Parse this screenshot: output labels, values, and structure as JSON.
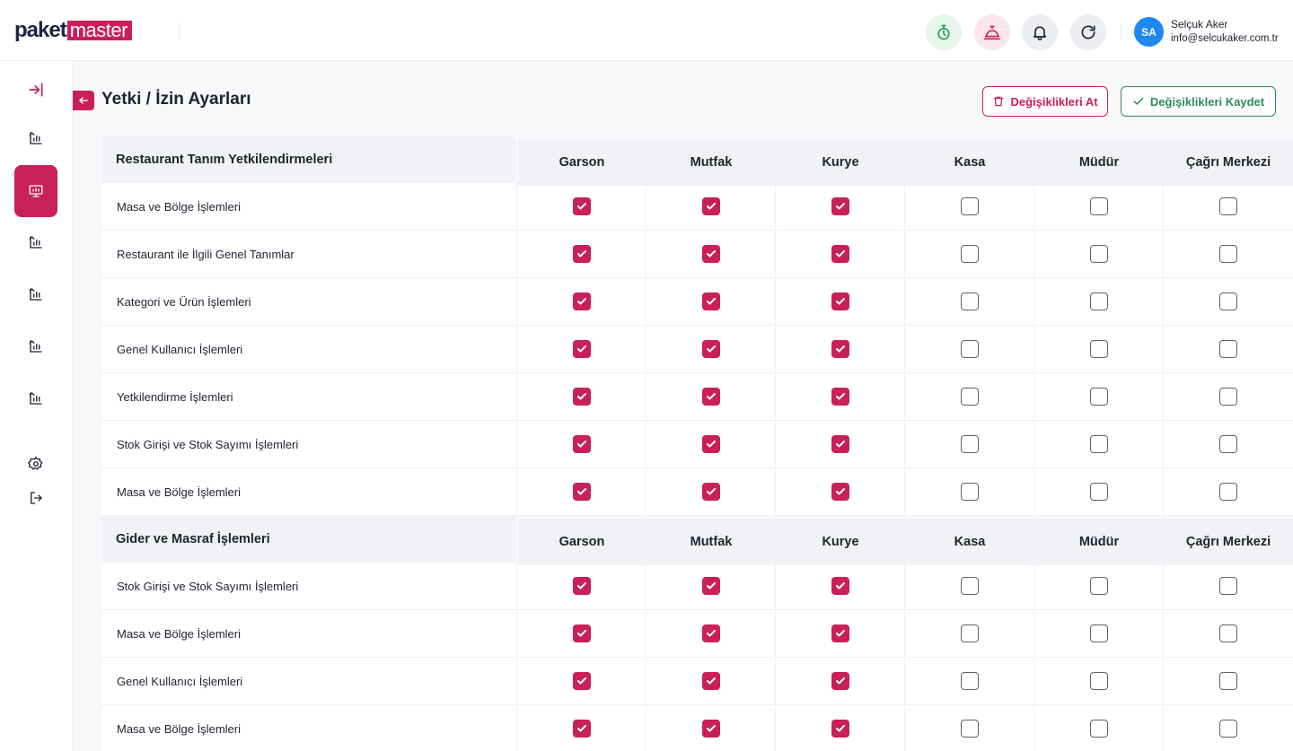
{
  "brand": {
    "left": "paket",
    "right": "master"
  },
  "user": {
    "initials": "SA",
    "name": "Selçuk Aker",
    "email": "info@selcukaker.com.tr"
  },
  "header_icons": [
    "timer-icon",
    "service-bell-icon",
    "notification-bell-icon",
    "refresh-icon"
  ],
  "page": {
    "title": "Yetki / İzin Ayarları"
  },
  "actions": {
    "discard_label": "Değişiklikleri At",
    "save_label": "Değişiklikleri Kaydet"
  },
  "roles": [
    "Garson",
    "Mutfak",
    "Kurye",
    "Kasa",
    "Müdür",
    "Çağrı Merkezi"
  ],
  "groups": [
    {
      "title": "Restaurant Tanım Yetkilendirmeleri",
      "rows": [
        {
          "label": "Masa ve Bölge İşlemleri",
          "checks": [
            true,
            true,
            true,
            false,
            false,
            false
          ]
        },
        {
          "label": "Restaurant ile İlgili Genel Tanımlar",
          "checks": [
            true,
            true,
            true,
            false,
            false,
            false
          ]
        },
        {
          "label": "Kategori ve Ürün İşlemleri",
          "checks": [
            true,
            true,
            true,
            false,
            false,
            false
          ]
        },
        {
          "label": "Genel Kullanıcı İşlemleri",
          "checks": [
            true,
            true,
            true,
            false,
            false,
            false
          ]
        },
        {
          "label": "Yetkilendirme İşlemleri",
          "checks": [
            true,
            true,
            true,
            false,
            false,
            false
          ]
        },
        {
          "label": "Stok Girişi ve Stok Sayımı İşlemleri",
          "checks": [
            true,
            true,
            true,
            false,
            false,
            false
          ]
        },
        {
          "label": "Masa ve Bölge İşlemleri",
          "checks": [
            true,
            true,
            true,
            false,
            false,
            false
          ]
        }
      ]
    },
    {
      "title": "Gider ve Masraf İşlemleri",
      "rows": [
        {
          "label": "Stok Girişi ve Stok Sayımı İşlemleri",
          "checks": [
            true,
            true,
            true,
            false,
            false,
            false
          ]
        },
        {
          "label": "Masa ve Bölge İşlemleri",
          "checks": [
            true,
            true,
            true,
            false,
            false,
            false
          ]
        },
        {
          "label": "Genel Kullanıcı İşlemleri",
          "checks": [
            true,
            true,
            true,
            false,
            false,
            false
          ]
        },
        {
          "label": "Masa ve Bölge İşlemleri",
          "checks": [
            true,
            true,
            true,
            false,
            false,
            false
          ]
        }
      ]
    }
  ],
  "colors": {
    "accent": "#c91f5a",
    "save": "#2e8b57",
    "avatar": "#1e88f0"
  }
}
